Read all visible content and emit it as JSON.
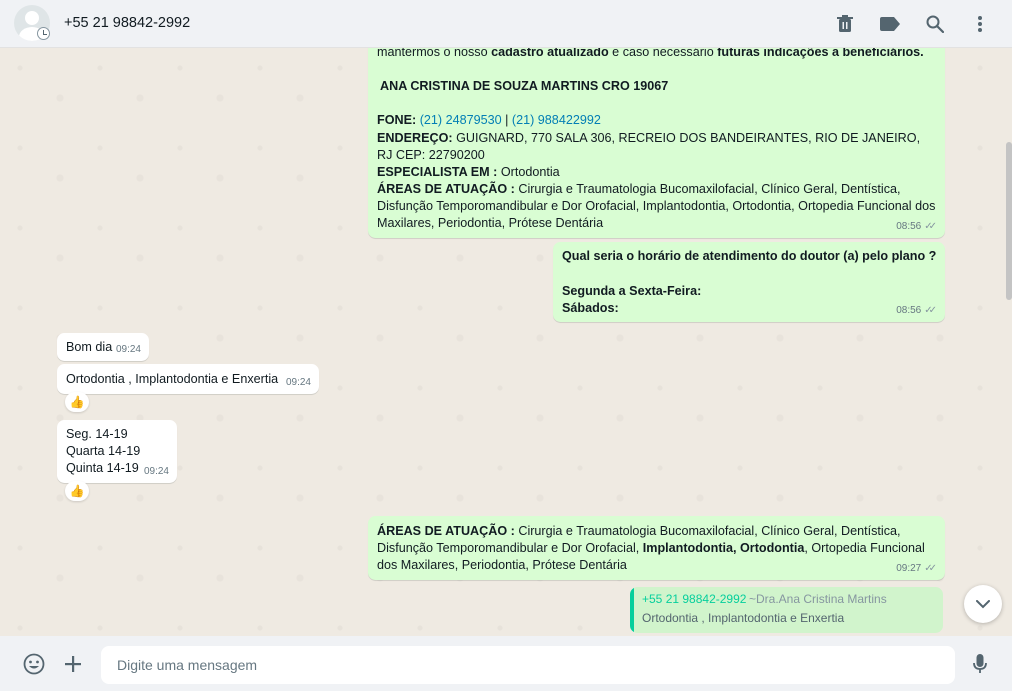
{
  "header": {
    "contact_name": "+55 21 98842-2992",
    "icons": [
      "trash-icon",
      "label-icon",
      "search-icon",
      "menu-icon"
    ]
  },
  "messages": {
    "m1": {
      "line_intro_a": "mantermos o nosso ",
      "line_intro_b": "cadastro atualizado",
      "line_intro_c": " e caso necessário ",
      "line_intro_d": "futuras indicações a beneficiários.",
      "name_line": "ANA CRISTINA DE SOUZA MARTINS CRO 19067",
      "phone_label": "FONE:",
      "phone_1": "(21) 24879530",
      "phone_sep": " | ",
      "phone_2": "(21) 988422992",
      "address_label": "ENDEREÇO:",
      "address_text": " GUIGNARD, 770 SALA 306, RECREIO DOS BANDEIRANTES, RIO DE JANEIRO, RJ CEP: 22790200",
      "specialist_label": "ESPECIALISTA EM :",
      "specialist_text": " Ortodontia",
      "areas_label": "ÁREAS DE ATUAÇÃO :",
      "areas_text": " Cirurgia e Traumatologia Bucomaxilofacial, Clínico Geral, Dentística, Disfunção Temporomandibular e Dor Orofacial, Implantodontia, Ortodontia, Ortopedia Funcional dos Maxilares, Periodontia, Prótese Dentária",
      "time": "08:56"
    },
    "m2": {
      "line_1": "Qual seria o horário de atendimento do doutor (a) pelo plano ?",
      "line_2": "Segunda a Sexta-Feira:",
      "line_3": "Sábados:",
      "time": "08:56"
    },
    "m3": {
      "text": "Bom dia",
      "time": "09:24"
    },
    "m4": {
      "text": "Ortodontia , Implantodontia e Enxertia",
      "time": "09:24",
      "reaction": "👍"
    },
    "m5": {
      "line_1": "Seg. 14-19",
      "line_2": "Quarta 14-19",
      "line_3": "Quinta 14-19",
      "time": "09:24",
      "reaction": "👍"
    },
    "m6": {
      "areas_label": "ÁREAS DE ATUAÇÃO :",
      "text_a": " Cirurgia e Traumatologia Bucomaxilofacial, Clínico Geral, Dentística, Disfunção Temporomandibular e Dor Orofacial, ",
      "bold_1": "Implantodontia",
      "comma": ", ",
      "bold_2": "Ortodontia",
      "text_b": ", Ortopedia Funcional dos Maxilares, Periodontia, Prótese Dentária",
      "time": "09:27"
    },
    "quoted": {
      "author": "+55 21 98842-2992",
      "push_name": "~Dra.Ana Cristina Martins",
      "text": "Ortodontia , Implantodontia e Enxertia"
    }
  },
  "footer": {
    "placeholder": "Digite uma mensagem"
  },
  "colors": {
    "outgoing_bubble": "#d9fdd3",
    "incoming_bubble": "#ffffff",
    "link": "#027eb5",
    "quote_accent": "#06cf9c",
    "chat_bg": "#efeae2"
  }
}
